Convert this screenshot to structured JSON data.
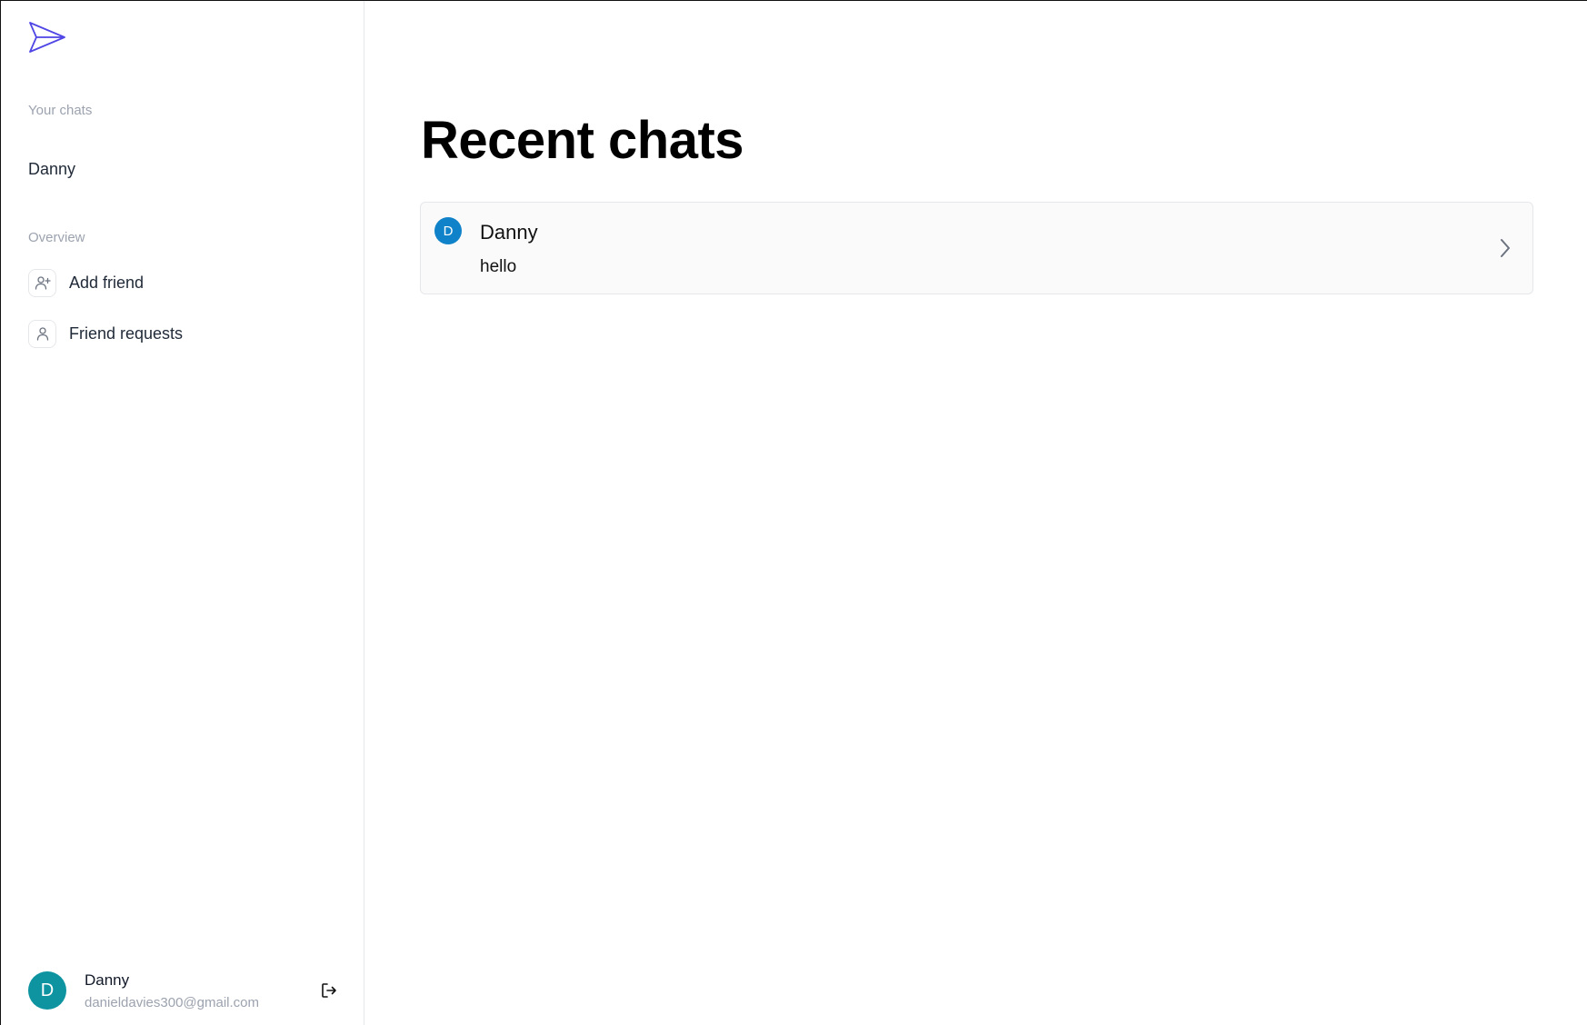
{
  "sidebar": {
    "logo_icon": "paper-plane-icon",
    "your_chats_label": "Your chats",
    "chats": [
      {
        "name": "Danny"
      }
    ],
    "overview_label": "Overview",
    "nav": [
      {
        "label": "Add friend",
        "icon": "user-plus-icon"
      },
      {
        "label": "Friend requests",
        "icon": "user-icon"
      }
    ],
    "profile": {
      "initial": "D",
      "name": "Danny",
      "email": "danieldavies300@gmail.com",
      "logout_icon": "logout-icon"
    }
  },
  "main": {
    "title": "Recent chats",
    "recent": [
      {
        "initial": "D",
        "name": "Danny",
        "last_message": "hello",
        "icon": "chevron-right-icon"
      }
    ]
  },
  "colors": {
    "brand": "#4f46e5",
    "avatar_profile": "#0e94a0",
    "avatar_chat": "#0f82c9",
    "muted_text": "#9ca3af"
  }
}
